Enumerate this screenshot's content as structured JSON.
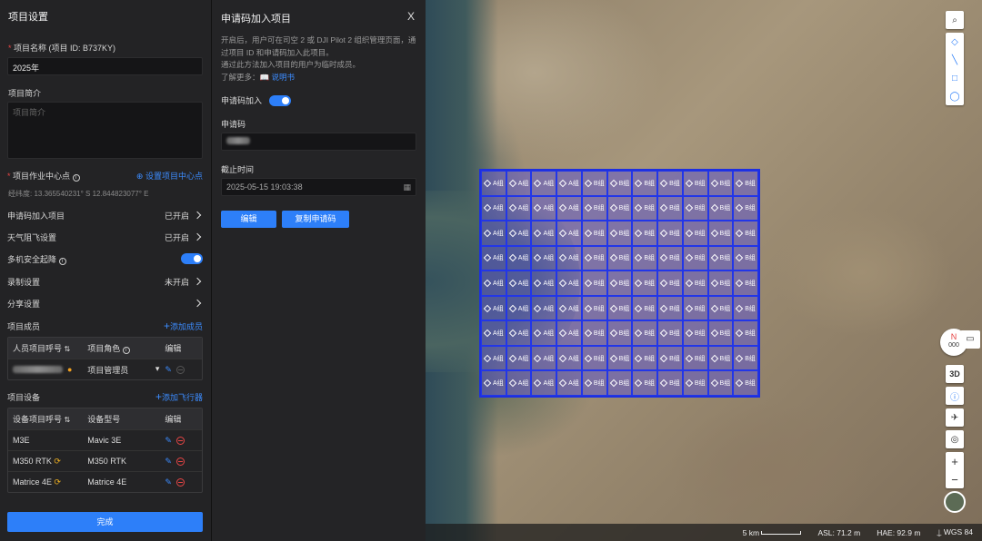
{
  "left": {
    "title": "项目设置",
    "name_label": "项目名称 (项目 ID: B737KY)",
    "name_value": "2025年",
    "intro_label": "项目简介",
    "intro_placeholder": "项目简介",
    "center_label": "项目作业中心点",
    "set_center": "设置项目中心点",
    "coords": "经纬度:  13.365540231° S 12.844823077° E",
    "settings": [
      {
        "label": "申请码加入项目",
        "status": "已开启"
      },
      {
        "label": "天气阻飞设置",
        "status": "已开启"
      },
      {
        "label": "多机安全起降",
        "status": ""
      },
      {
        "label": "录制设置",
        "status": "未开启"
      },
      {
        "label": "分享设置",
        "status": ""
      }
    ],
    "members_label": "项目成员",
    "add_member": "添加成员",
    "members_headers": [
      "人员项目呼号",
      "项目角色",
      "编辑"
    ],
    "member_role": "项目管理员",
    "devices_label": "项目设备",
    "add_device": "添加飞行器",
    "devices_headers": [
      "设备项目呼号",
      "设备型号",
      "编辑"
    ],
    "devices": [
      {
        "callsign": "M3E",
        "model": "Mavic 3E"
      },
      {
        "callsign": "M350 RTK",
        "model": "M350 RTK"
      },
      {
        "callsign": "Matrice 4E",
        "model": "Matrice 4E"
      }
    ],
    "done": "完成"
  },
  "modal": {
    "title": "申请码加入项目",
    "close": "X",
    "desc1": "开启后，用户可在司空 2 或 DJI Pilot 2 组织管理页面，通过项目 ID 和申请码加入此项目。",
    "desc2": "通过此方法加入项目的用户为临时成员。",
    "learn": "了解更多：",
    "manual": "说明书",
    "toggle_label": "申请码加入",
    "code_label": "申请码",
    "deadline_label": "截止时间",
    "deadline": "2025-05-15 19:03:38",
    "edit": "编辑",
    "copy": "复制申请码"
  },
  "map": {
    "scale": "5 km",
    "asl": "ASL: 71.2 m",
    "hae": "HAE: 92.9 m",
    "datum": "WGS 84",
    "compass_n": "N",
    "compass_v": "000",
    "btn_3d": "3D",
    "plus": "+",
    "minus": "−",
    "cell_a": "A组",
    "cell_b": "B组"
  }
}
